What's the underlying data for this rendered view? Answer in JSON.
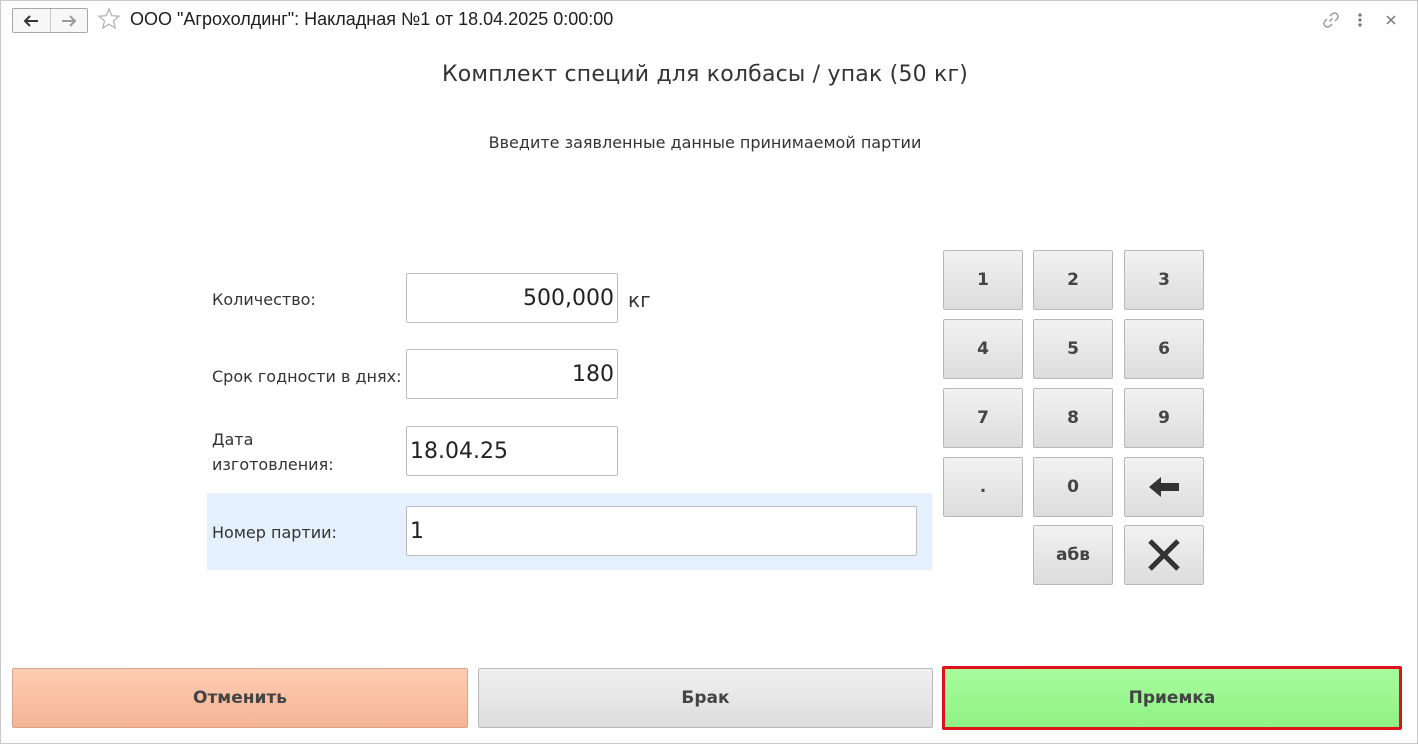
{
  "window": {
    "title": "ООО \"Агрохолдинг\": Накладная №1 от 18.04.2025 0:00:00"
  },
  "product": {
    "title": "Комплект специй для колбасы / упак (50 кг)"
  },
  "instruction": "Введите заявленные данные принимаемой партии",
  "form": {
    "quantity": {
      "label": "Количество:",
      "value": "500,000",
      "unit": "кг"
    },
    "shelf_life": {
      "label": "Срок годности в днях:",
      "value": "180"
    },
    "manufacture_date": {
      "label_line1": "Дата",
      "label_line2": "изготовления:",
      "value": "18.04.25"
    },
    "batch_number": {
      "label": "Номер партии:",
      "value": "1"
    }
  },
  "keypad": {
    "keys": [
      "1",
      "2",
      "3",
      "4",
      "5",
      "6",
      "7",
      "8",
      "9",
      ".",
      "0"
    ],
    "abc_label": "абв"
  },
  "actions": {
    "cancel_label": "Отменить",
    "defect_label": "Брак",
    "accept_label": "Приемка"
  },
  "colors": {
    "cancel": "#f8bea2",
    "accept": "#97f58b",
    "accept_border": "#e0101d",
    "active_row": "#e4f0fb"
  }
}
